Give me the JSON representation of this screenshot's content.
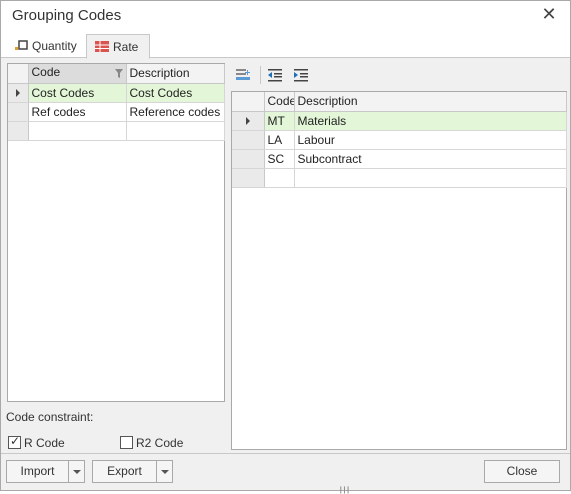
{
  "window": {
    "title": "Grouping Codes"
  },
  "tabs": [
    {
      "label": "Quantity",
      "icon": "quantity-icon",
      "active": false
    },
    {
      "label": "Rate",
      "icon": "rate-grid-icon",
      "active": true
    }
  ],
  "left_grid": {
    "columns": [
      "Code",
      "Description"
    ],
    "rows": [
      {
        "code": "Cost Codes",
        "description": "Cost Codes",
        "selected": true
      },
      {
        "code": "Ref codes",
        "description": "Reference codes",
        "selected": false
      },
      {
        "code": "",
        "description": "",
        "selected": false
      }
    ]
  },
  "right_grid": {
    "toolbar": [
      "add-group-icon",
      "outdent-icon",
      "indent-icon"
    ],
    "columns": [
      "Code",
      "Description"
    ],
    "rows": [
      {
        "code": "MT",
        "description": "Materials",
        "selected": true
      },
      {
        "code": "LA",
        "description": "Labour",
        "selected": false
      },
      {
        "code": "SC",
        "description": "Subcontract",
        "selected": false
      },
      {
        "code": "",
        "description": "",
        "selected": false
      }
    ]
  },
  "constraint": {
    "label": "Code constraint:",
    "options": [
      {
        "label": "R Code",
        "checked": true
      },
      {
        "label": "R2 Code",
        "checked": false
      }
    ]
  },
  "buttons": {
    "import": "Import",
    "export": "Export",
    "close": "Close"
  },
  "colors": {
    "selected_row": "#e3f7d8",
    "dialog_bg": "#f0f0f0"
  }
}
